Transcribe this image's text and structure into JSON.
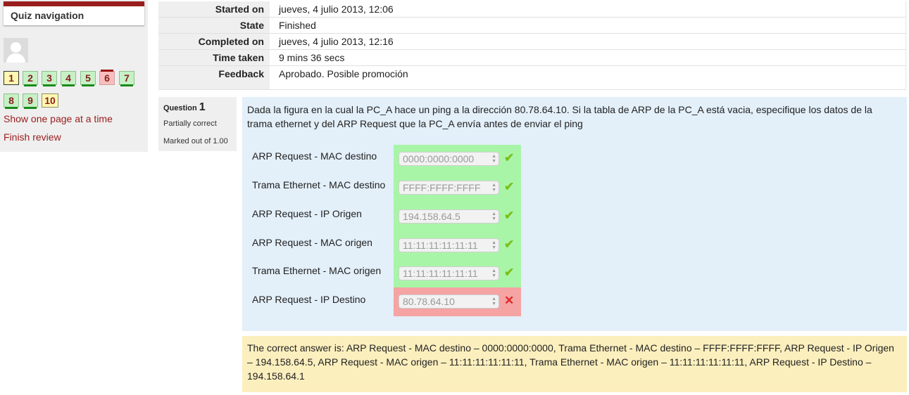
{
  "nav": {
    "title": "Quiz navigation",
    "buttons": [
      "1",
      "2",
      "3",
      "4",
      "5",
      "6",
      "7",
      "8",
      "9",
      "10"
    ],
    "show_one_page": "Show one page at a time",
    "finish_review": "Finish review"
  },
  "summary": {
    "rows": [
      {
        "label": "Started on",
        "value": "jueves, 4 julio 2013, 12:06"
      },
      {
        "label": "State",
        "value": "Finished"
      },
      {
        "label": "Completed on",
        "value": "jueves, 4 julio 2013, 12:16"
      },
      {
        "label": "Time taken",
        "value": "9 mins 36 secs"
      },
      {
        "label": "Feedback",
        "value": "Aprobado. Posible promoción"
      }
    ]
  },
  "question": {
    "prefix": "Question",
    "number": "1",
    "state": "Partially correct",
    "grade": "Marked out of 1.00",
    "text": "Dada la figura en la cual la PC_A hace un ping a la dirección 80.78.64.10. Si la tabla de ARP de la PC_A está vacia, especifique los datos de la trama ethernet y del ARP Request que la PC_A envía antes de enviar el ping",
    "items": [
      {
        "label": "ARP Request - MAC destino",
        "value": "0000:0000:0000",
        "mark": "✔"
      },
      {
        "label": "Trama Ethernet - MAC destino",
        "value": "FFFF:FFFF:FFFF",
        "mark": "✔"
      },
      {
        "label": "ARP Request - IP Origen",
        "value": "194.158.64.5",
        "mark": "✔"
      },
      {
        "label": "ARP Request - MAC origen",
        "value": "11:11:11:11:11:11",
        "mark": "✔"
      },
      {
        "label": "Trama Ethernet - MAC origen",
        "value": "11:11:11:11:11:11",
        "mark": "✔"
      },
      {
        "label": "ARP Request - IP Destino",
        "value": "80.78.64.10",
        "mark": "✕"
      }
    ],
    "right_answer": "The correct answer is: ARP Request - MAC destino – 0000:0000:0000, Trama Ethernet - MAC destino – FFFF:FFFF:FFFF, ARP Request - IP Origen – 194.158.64.5, ARP Request - MAC origen – 11:11:11:11:11:11, Trama Ethernet - MAC origen – 11:11:11:11:11:11, ARP Request - IP Destino – 194.158.64.1"
  },
  "colors": {
    "brand": "#9a1d1d",
    "correct_bg": "#a8f5a8",
    "incorrect_bg": "#f5a3a3",
    "question_bg": "#e3eff9",
    "right_answer_bg": "#fcefbe"
  },
  "icons": {
    "avatar": "user-avatar-icon",
    "correct": "check-icon",
    "incorrect": "cross-icon",
    "select_arrows": "up-down-arrows-icon"
  }
}
